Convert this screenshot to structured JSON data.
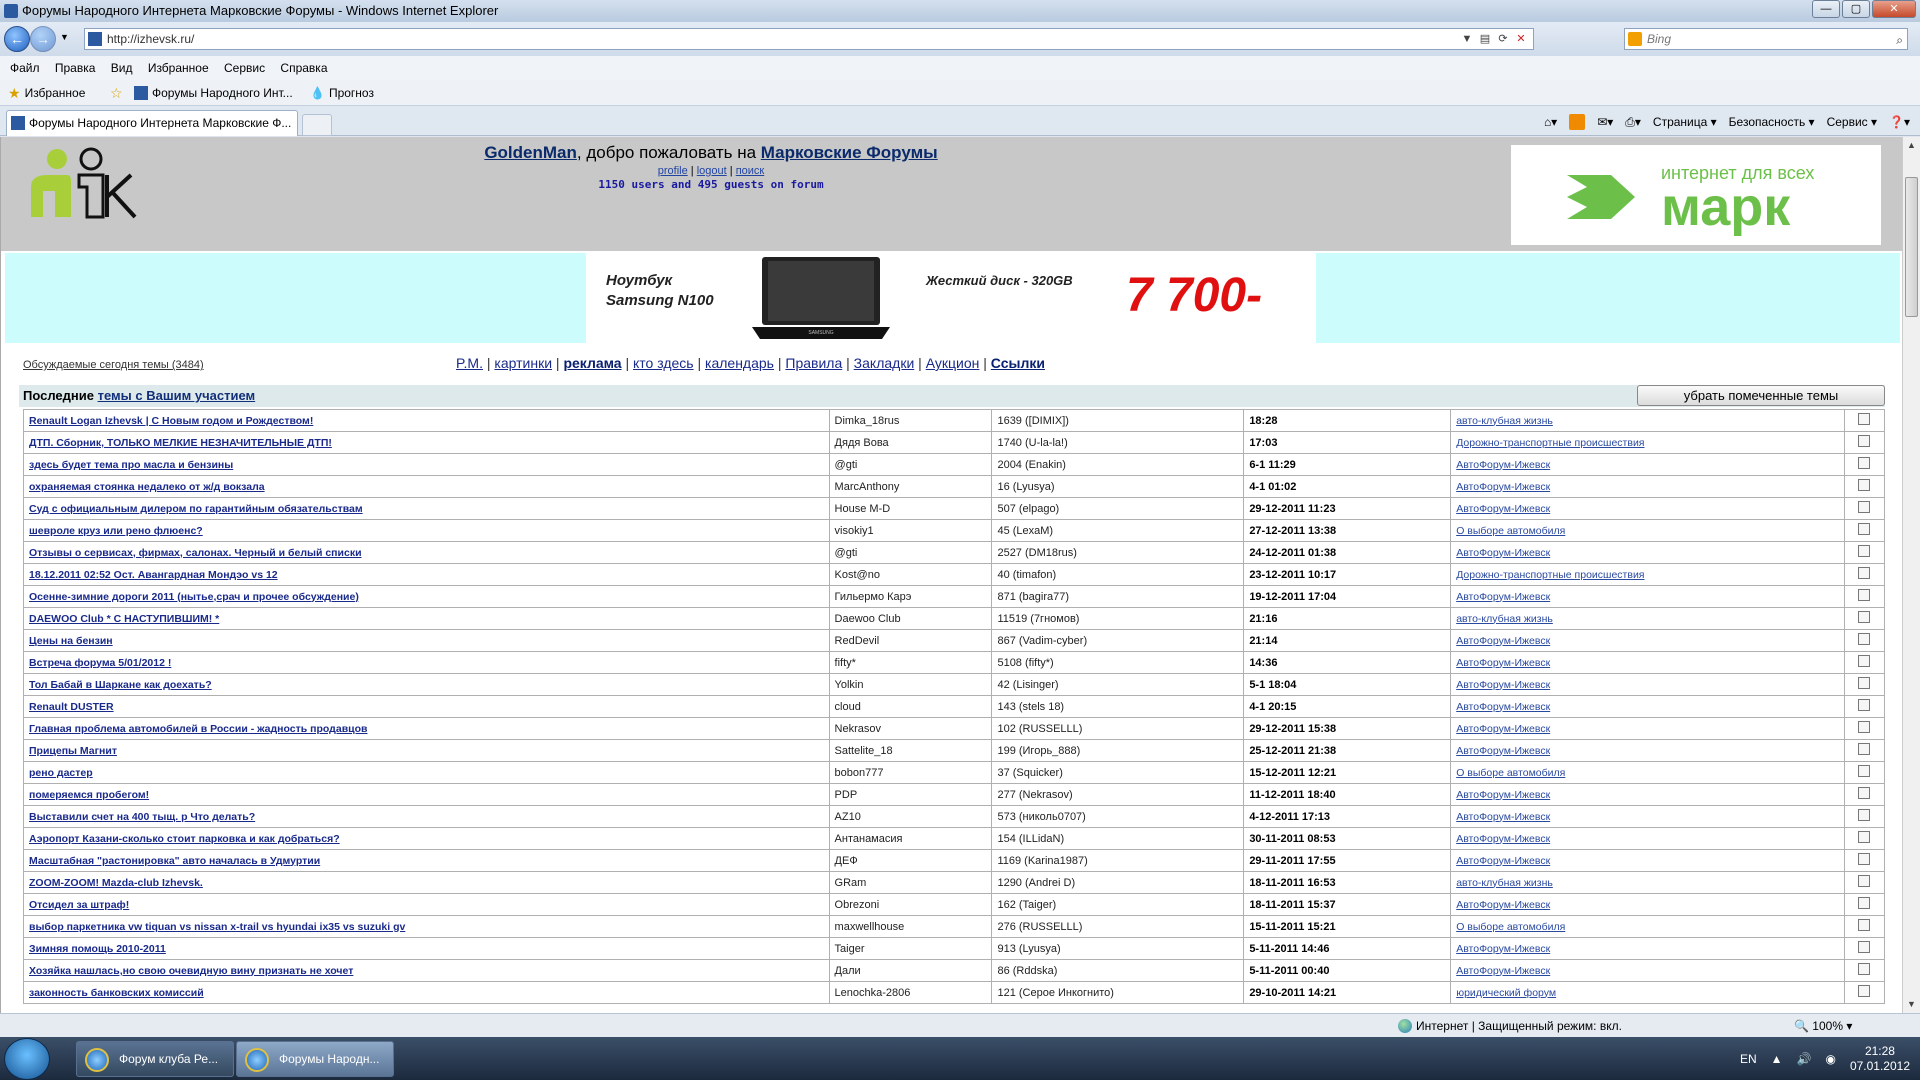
{
  "window": {
    "title": "Форумы Народного Интернета Марковские Форумы - Windows Internet Explorer"
  },
  "address": {
    "url": "http://izhevsk.ru/"
  },
  "search": {
    "placeholder": "Bing"
  },
  "menu": [
    "Файл",
    "Правка",
    "Вид",
    "Избранное",
    "Сервис",
    "Справка"
  ],
  "favorites": {
    "label": "Избранное",
    "items": [
      "Форумы Народного Инт...",
      "Прогноз"
    ]
  },
  "tab": {
    "title": "Форумы Народного Интернета Марковские Ф..."
  },
  "commandbar": {
    "page": "Страница",
    "safety": "Безопасность",
    "tools": "Сервис"
  },
  "header": {
    "user": "GoldenMan",
    "welcome_text": ", добро пожаловать на ",
    "forum_name": "Марковские Форумы",
    "links": [
      "profile",
      "logout",
      "поиск"
    ],
    "online": "1150 users and 495 guests on forum"
  },
  "mark_logo": {
    "tagline": "интернет для всех",
    "brand": "марк"
  },
  "ad": {
    "product_line1": "Ноутбук",
    "product_line2": "Samsung N100",
    "disk": "Жесткий диск - 320GB",
    "price": "7 700-",
    "laptop_brand": "SAMSUNG"
  },
  "nav": {
    "today_topics": "Обсуждаемые сегодня темы (3484)",
    "links": [
      "P.M.",
      "картинки",
      "реклама",
      "кто здесь",
      "календарь",
      "Правила",
      "Закладки",
      "Аукцион",
      "Ссылки"
    ]
  },
  "topics": {
    "heading_prefix": "Последние ",
    "heading_link": "темы с Вашим участием",
    "remove_button": "убрать помеченные темы",
    "rows": [
      {
        "title": "Renault Logan Izhevsk | С Новым годом и Рождеством!",
        "author": "Dimka_18rus",
        "last": "1639 ([DIMIX])",
        "date": "18:28",
        "forum": "авто-клубная жизнь"
      },
      {
        "title": "ДТП. Сборник, ТОЛЬКО МЕЛКИЕ НЕЗНАЧИТЕЛЬНЫЕ ДТП!",
        "author": "Дядя Вова",
        "last": "1740 (U-la-la!)",
        "date": "17:03",
        "forum": "Дорожно-транспортные происшествия"
      },
      {
        "title": "здесь будет тема про масла и бензины",
        "author": "@gti",
        "last": "2004 (Enakin)",
        "date": "6-1 11:29",
        "forum": "АвтоФорум-Ижевск"
      },
      {
        "title": "охраняемая стоянка недалеко от ж/д вокзала",
        "author": "MarcAnthony",
        "last": "16 (Lyusya)",
        "date": "4-1 01:02",
        "forum": "АвтоФорум-Ижевск"
      },
      {
        "title": "Суд с официальным дилером по гарантийным обязательствам",
        "author": "House M-D",
        "last": "507 (elpago)",
        "date": "29-12-2011 11:23",
        "forum": "АвтоФорум-Ижевск"
      },
      {
        "title": "шевроле круз или рено флюенс?",
        "author": "visokiy1",
        "last": "45 (LexaM)",
        "date": "27-12-2011 13:38",
        "forum": "О выборе автомобиля"
      },
      {
        "title": "Отзывы о сервисах, фирмах, салонах. Черный и белый списки",
        "author": "@gti",
        "last": "2527 (DM18rus)",
        "date": "24-12-2011 01:38",
        "forum": "АвтоФорум-Ижевск"
      },
      {
        "title": "18.12.2011 02:52 Ост. Авангардная Мондэо vs 12",
        "author": "Kost@no",
        "last": "40 (timafon)",
        "date": "23-12-2011 10:17",
        "forum": "Дорожно-транспортные происшествия"
      },
      {
        "title": "Осенне-зимние дороги 2011 (нытье,срач и прочее обсуждение)",
        "author": "Гильермо Карэ",
        "last": "871 (bagira77)",
        "date": "19-12-2011 17:04",
        "forum": "АвтоФорум-Ижевск"
      },
      {
        "title": "DAEWOO Club * С НАСТУПИВШИМ! *",
        "author": "Daewoo Club",
        "last": "11519 (7гномов)",
        "date": "21:16",
        "forum": "авто-клубная жизнь"
      },
      {
        "title": "Цены на бензин",
        "author": "RedDevil",
        "last": "867 (Vadim-cyber)",
        "date": "21:14",
        "forum": "АвтоФорум-Ижевск"
      },
      {
        "title": "Встреча форума 5/01/2012 !",
        "author": "fifty*",
        "last": "5108 (fifty*)",
        "date": "14:36",
        "forum": "АвтоФорум-Ижевск"
      },
      {
        "title": "Тол Бабай в Шаркане как доехать?",
        "author": "Yolkin",
        "last": "42 (Lisinger)",
        "date": "5-1 18:04",
        "forum": "АвтоФорум-Ижевск"
      },
      {
        "title": "Renault DUSTER",
        "author": "cloud",
        "last": "143 (stels 18)",
        "date": "4-1 20:15",
        "forum": "АвтоФорум-Ижевск"
      },
      {
        "title": "Главная проблема автомобилей в России - жадность продавцов",
        "author": "Nekrasov",
        "last": "102 (RUSSELLL)",
        "date": "29-12-2011 15:38",
        "forum": "АвтоФорум-Ижевск"
      },
      {
        "title": "Прицепы Магнит",
        "author": "Sattelite_18",
        "last": "199 (Игорь_888)",
        "date": "25-12-2011 21:38",
        "forum": "АвтоФорум-Ижевск"
      },
      {
        "title": "рено дастер",
        "author": "bobon777",
        "last": "37 (Squicker)",
        "date": "15-12-2011 12:21",
        "forum": "О выборе автомобиля"
      },
      {
        "title": "померяемся пробегом!",
        "author": "PDP",
        "last": "277 (Nekrasov)",
        "date": "11-12-2011 18:40",
        "forum": "АвтоФорум-Ижевск"
      },
      {
        "title": "Выставили счет на 400 тыщ. р Что делать?",
        "author": "AZ10",
        "last": "573 (николь0707)",
        "date": "4-12-2011 17:13",
        "forum": "АвтоФорум-Ижевск"
      },
      {
        "title": "Аэропорт Казани-сколько стоит парковка и как добраться?",
        "author": "Антанамасия",
        "last": "154 (ILLidaN)",
        "date": "30-11-2011 08:53",
        "forum": "АвтоФорум-Ижевск"
      },
      {
        "title": "Масштабная \"растонировка\" авто началась в Удмуртии",
        "author": "ДЕФ",
        "last": "1169 (Karina1987)",
        "date": "29-11-2011 17:55",
        "forum": "АвтоФорум-Ижевск"
      },
      {
        "title": "ZOOM-ZOOM! Mazda-club Izhevsk.",
        "author": "GRam",
        "last": "1290 (Andrei D)",
        "date": "18-11-2011 16:53",
        "forum": "авто-клубная жизнь"
      },
      {
        "title": "Отсидел за штраф!",
        "author": "Obrezoni",
        "last": "162 (Taiger)",
        "date": "18-11-2011 15:37",
        "forum": "АвтоФорум-Ижевск"
      },
      {
        "title": "выбор паркетника vw tiquan vs nissan x-trail vs hyundai ix35 vs suzuki gv",
        "author": "maxwellhouse",
        "last": "276 (RUSSELLL)",
        "date": "15-11-2011 15:21",
        "forum": "О выборе автомобиля"
      },
      {
        "title": "Зимняя помощь 2010-2011",
        "author": "Taiger",
        "last": "913 (Lyusya)",
        "date": "5-11-2011 14:46",
        "forum": "АвтоФорум-Ижевск"
      },
      {
        "title": "Хозяйка нашлась,но свою очевидную вину признать не хочет",
        "author": "Дали",
        "last": "86 (Rddska)",
        "date": "5-11-2011 00:40",
        "forum": "АвтоФорум-Ижевск"
      },
      {
        "title": "законность банковских комиссий",
        "author": "Lenochka-2806",
        "last": "121 (Серое Инкогнито)",
        "date": "29-10-2011 14:21",
        "forum": "юридический форум"
      }
    ]
  },
  "statusbar": {
    "zone": "Интернет | Защищенный режим: вкл.",
    "zoom": "100%"
  },
  "taskbar": {
    "tasks": [
      "Форум клуба Ре...",
      "Форумы Народн..."
    ],
    "lang": "EN",
    "time": "21:28",
    "date": "07.01.2012"
  },
  "colors": {
    "header_bg": "#c8c8c8",
    "banner_bg": "#ccfcfc",
    "mark_green": "#6cc04a",
    "price_red": "#e01010"
  }
}
